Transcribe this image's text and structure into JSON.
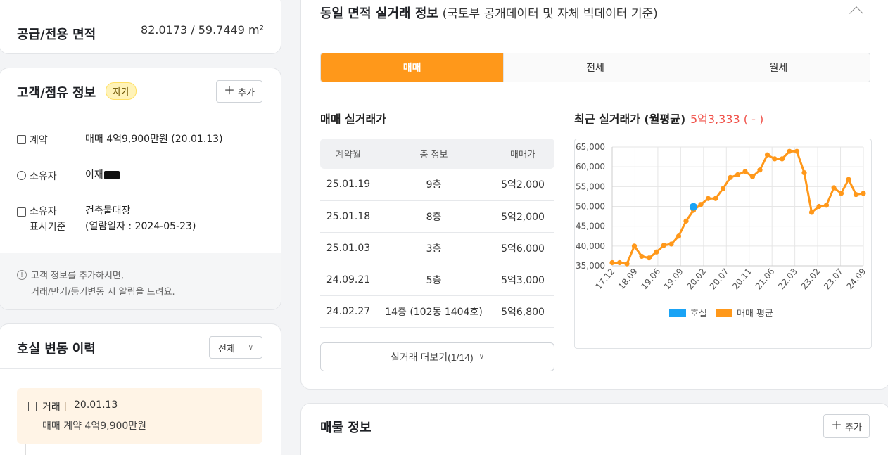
{
  "area": {
    "label": "공급/전용 면적",
    "value": "82.0173 / 59.7449 m²"
  },
  "owner": {
    "title": "고객/점유 정보",
    "badge": "자가",
    "add_label": "추가",
    "rows": [
      {
        "label": "계약",
        "value": "매매 4억9,900만원 (20.01.13)"
      },
      {
        "label": "소유자",
        "value": "이재"
      },
      {
        "label1": "소유자",
        "label2": "표시기준",
        "value1": "건축물대장",
        "value2": "(열람일자 : 2024-05-23)"
      }
    ],
    "notice_line1": "고객 정보를 추가하시면,",
    "notice_line2": "거래/만기/등기변동 시 알림을 드려요."
  },
  "history": {
    "title": "호실 변동 이력",
    "filter": "전체",
    "item_type": "거래",
    "item_date": "20.01.13",
    "item_desc": "매매 계약 4억9,900만원"
  },
  "trade": {
    "title": "동일 면적 실거래 정보",
    "subtitle": "(국토부 공개데이터 및 자체 빅데이터 기준)",
    "tabs": [
      "매매",
      "전세",
      "월세"
    ],
    "section_title": "매매 실거래가",
    "headers": [
      "계약월",
      "층 정보",
      "매매가"
    ],
    "rows": [
      [
        "25.01.19",
        "9층",
        "5억2,000"
      ],
      [
        "25.01.18",
        "8층",
        "5억2,000"
      ],
      [
        "25.01.03",
        "3층",
        "5억6,000"
      ],
      [
        "24.09.21",
        "5층",
        "5억3,000"
      ],
      [
        "24.02.27",
        "14층 (102동 1404호)",
        "5억6,800"
      ]
    ],
    "more_label": "실거래 더보기(1/14)",
    "recent_label": "최근 실거래가 (월평균)",
    "recent_value": "5억3,333 ( - )"
  },
  "listing": {
    "title": "매물 정보",
    "add_label": "추가"
  },
  "colors": {
    "accent": "#ff981a",
    "unit_point": "#1aa3f5",
    "recent": "#f0524a"
  },
  "chart_data": {
    "type": "line",
    "y_ticks": [
      "65,000",
      "60,000",
      "55,000",
      "50,000",
      "45,000",
      "40,000",
      "35,000"
    ],
    "x_ticks": [
      "17.12",
      "18.09",
      "19.06",
      "19.09",
      "20.02",
      "20.07",
      "20.11",
      "21.06",
      "22.03",
      "23.02",
      "23.07",
      "24.09"
    ],
    "ylim": [
      35000,
      65000
    ],
    "legend": "bottom",
    "series": [
      {
        "name": "매매 평균",
        "values": [
          35800,
          35800,
          35500,
          40000,
          37400,
          37000,
          38500,
          40200,
          40500,
          42500,
          46300,
          49000,
          50500,
          52000,
          52000,
          54500,
          57300,
          58000,
          58800,
          57500,
          59200,
          63000,
          62000,
          62000,
          63900,
          63900,
          58500,
          48500,
          50000,
          50300,
          54700,
          53300,
          56800,
          53000,
          53300
        ]
      },
      {
        "name": "호실",
        "point_index": 11,
        "value": 49900
      }
    ]
  }
}
